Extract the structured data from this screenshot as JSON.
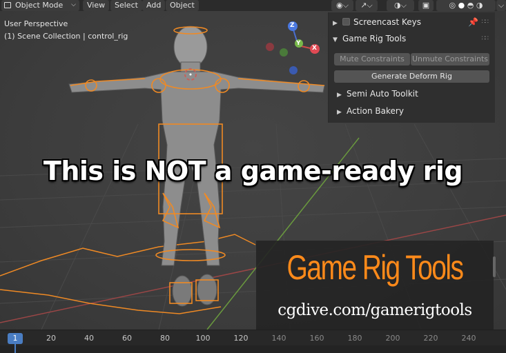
{
  "header": {
    "mode": "Object Mode",
    "menus": [
      "View",
      "Select",
      "Add",
      "Object"
    ]
  },
  "viewport": {
    "perspective": "User Perspective",
    "collection": "(1) Scene Collection | control_rig",
    "gizmo": {
      "z": "Z",
      "y": "Y",
      "x": "X"
    }
  },
  "panel": {
    "screencast_keys": "Screencast Keys",
    "section_title": "Game Rig Tools",
    "mute_constraints": "Mute Constraints",
    "unmute_constraints": "Unmute Constraints",
    "generate_deform_rig": "Generate Deform Rig",
    "semi_auto_toolkit": "Semi Auto Toolkit",
    "action_bakery": "Action Bakery"
  },
  "caption": "This is NOT a game-ready rig",
  "promo": {
    "title": "Game Rig Tools",
    "url": "cgdive.com/gamerigtools"
  },
  "timeline": {
    "current_frame": "1",
    "ticks": [
      "20",
      "40",
      "60",
      "80",
      "100",
      "120",
      "140",
      "160",
      "180",
      "200",
      "220",
      "240"
    ]
  },
  "colors": {
    "accent_orange": "#ff8a1a",
    "rig_orange": "#f08a24",
    "frame_blue": "#4a7dc2"
  }
}
